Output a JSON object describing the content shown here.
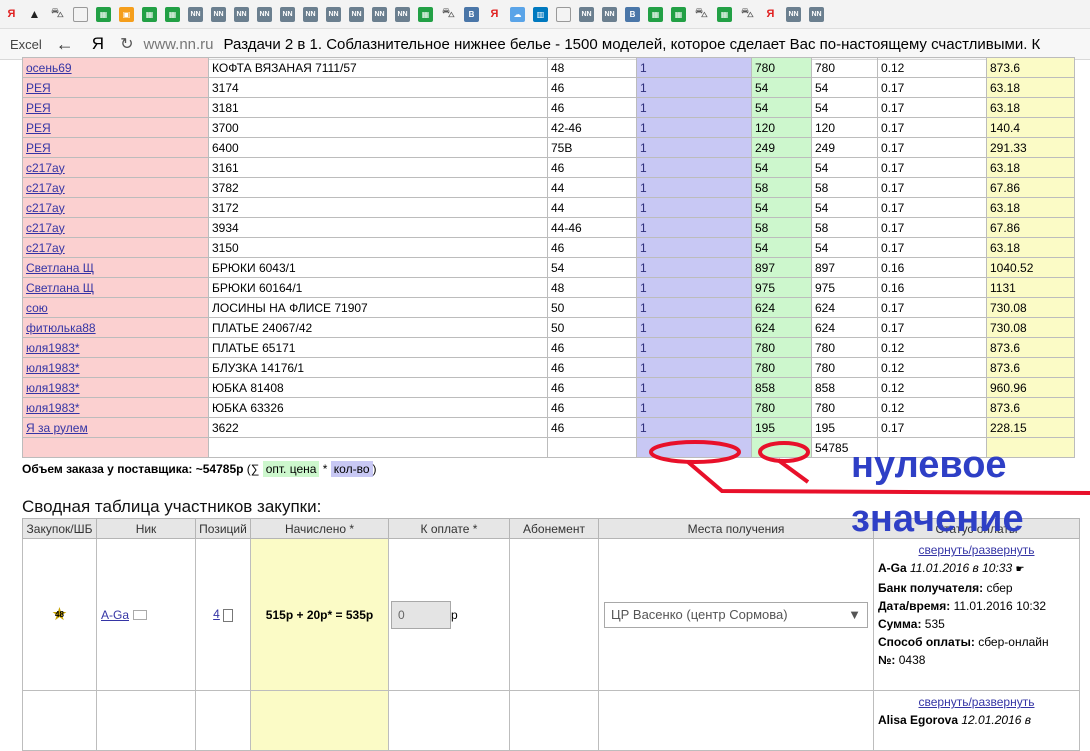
{
  "bookmarks": [
    "y-icon",
    "penguin-icon",
    "basket-icon",
    "doc-icon",
    "sheet-icon",
    "orange-icon",
    "sheet-icon",
    "sheet-icon",
    "nn-icon",
    "nn-icon",
    "nn-icon",
    "nn-icon",
    "nn-icon",
    "nn-icon",
    "nn-icon",
    "nn-icon",
    "nn-icon",
    "nn-icon",
    "sheet-icon",
    "basket-icon",
    "vk-icon",
    "y-icon",
    "cloud-icon",
    "trello-icon",
    "doc-icon",
    "nn-icon",
    "nn-icon",
    "vk-icon",
    "sheet-icon",
    "sheet-icon",
    "basket-icon",
    "sheet-icon",
    "basket-icon",
    "y-icon",
    "nn-icon",
    "nn-icon"
  ],
  "nn_label": "NN",
  "vk_label": "B",
  "y_label": "Я",
  "browser": {
    "app_label": "Excel",
    "back_glyph": "←",
    "logo": "Я",
    "reload_glyph": "↻",
    "url": "www.nn.ru",
    "page_title": "Раздачи 2 в 1. Соблазнительное нижнее белье - 1500 моделей, которое сделает Вас по-настоящему счастливыми. К"
  },
  "orders": [
    {
      "nick": "осень69",
      "item": "КОФТА ВЯЗАНАЯ 7111/57",
      "size": "48",
      "qty": "1",
      "price": "780",
      "price2": "780",
      "fee": "0.12",
      "total": "873.6"
    },
    {
      "nick": "РЕЯ",
      "item": "3174",
      "size": "46",
      "qty": "1",
      "price": "54",
      "price2": "54",
      "fee": "0.17",
      "total": "63.18"
    },
    {
      "nick": "РЕЯ",
      "item": "3181",
      "size": "46",
      "qty": "1",
      "price": "54",
      "price2": "54",
      "fee": "0.17",
      "total": "63.18"
    },
    {
      "nick": "РЕЯ",
      "item": "3700",
      "size": "42-46",
      "qty": "1",
      "price": "120",
      "price2": "120",
      "fee": "0.17",
      "total": "140.4"
    },
    {
      "nick": "РЕЯ",
      "item": "6400",
      "size": "75B",
      "qty": "1",
      "price": "249",
      "price2": "249",
      "fee": "0.17",
      "total": "291.33"
    },
    {
      "nick": "c217ay",
      "item": "3161",
      "size": "46",
      "qty": "1",
      "price": "54",
      "price2": "54",
      "fee": "0.17",
      "total": "63.18"
    },
    {
      "nick": "c217ay",
      "item": "3782",
      "size": "44",
      "qty": "1",
      "price": "58",
      "price2": "58",
      "fee": "0.17",
      "total": "67.86"
    },
    {
      "nick": "c217ay",
      "item": "3172",
      "size": "44",
      "qty": "1",
      "price": "54",
      "price2": "54",
      "fee": "0.17",
      "total": "63.18"
    },
    {
      "nick": "c217ay",
      "item": "3934",
      "size": "44-46",
      "qty": "1",
      "price": "58",
      "price2": "58",
      "fee": "0.17",
      "total": "67.86"
    },
    {
      "nick": "c217ay",
      "item": "3150",
      "size": "46",
      "qty": "1",
      "price": "54",
      "price2": "54",
      "fee": "0.17",
      "total": "63.18"
    },
    {
      "nick": "Светлана Щ",
      "item": "БРЮКИ 6043/1",
      "size": "54",
      "qty": "1",
      "price": "897",
      "price2": "897",
      "fee": "0.16",
      "total": "1040.52"
    },
    {
      "nick": "Светлана Щ",
      "item": "БРЮКИ 60164/1",
      "size": "48",
      "qty": "1",
      "price": "975",
      "price2": "975",
      "fee": "0.16",
      "total": "1131"
    },
    {
      "nick": "сою",
      "item": "ЛОСИНЫ НА ФЛИСЕ 71907",
      "size": "50",
      "qty": "1",
      "price": "624",
      "price2": "624",
      "fee": "0.17",
      "total": "730.08"
    },
    {
      "nick": "фитюлька88",
      "item": "ПЛАТЬЕ 24067/42",
      "size": "50",
      "qty": "1",
      "price": "624",
      "price2": "624",
      "fee": "0.17",
      "total": "730.08"
    },
    {
      "nick": "юля1983*",
      "item": "ПЛАТЬЕ 65171",
      "size": "46",
      "qty": "1",
      "price": "780",
      "price2": "780",
      "fee": "0.12",
      "total": "873.6"
    },
    {
      "nick": "юля1983*",
      "item": "БЛУЗКА 14176/1",
      "size": "46",
      "qty": "1",
      "price": "780",
      "price2": "780",
      "fee": "0.12",
      "total": "873.6"
    },
    {
      "nick": "юля1983*",
      "item": "ЮБКА 81408",
      "size": "46",
      "qty": "1",
      "price": "858",
      "price2": "858",
      "fee": "0.12",
      "total": "960.96"
    },
    {
      "nick": "юля1983*",
      "item": "ЮБКА 63326",
      "size": "46",
      "qty": "1",
      "price": "780",
      "price2": "780",
      "fee": "0.12",
      "total": "873.6"
    },
    {
      "nick": "Я за рулем",
      "item": "3622",
      "size": "46",
      "qty": "1",
      "price": "195",
      "price2": "195",
      "fee": "0.17",
      "total": "228.15"
    }
  ],
  "totals_row": {
    "sum": "54785"
  },
  "volume": {
    "label": "Объем заказа у поставщика:",
    "value": "~54785р",
    "open": "(∑",
    "chip_price": "опт. цена",
    "times": "*",
    "chip_qty": "кол-во",
    "close": ")"
  },
  "summary": {
    "title": "Сводная таблица участников закупки:",
    "headers": [
      "Закупок/ШБ",
      "Ник",
      "Позиций",
      "Начислено *",
      "К оплате *",
      "Абонемент",
      "Места получения",
      "Статус оплаты"
    ],
    "rows": [
      {
        "badge": "48",
        "nick": "A-Ga",
        "positions": "4",
        "formula": "515р + 20р* = 535р",
        "pay_value": "0",
        "pay_suffix": "р",
        "place": "ЦР Васенко (центр Сормова)",
        "toggle": "свернуть/развернуть",
        "pay_user": "A-Ga",
        "pay_time": "11.01.2016 в 10:33",
        "bank_label": "Банк получателя:",
        "bank_value": "сбер",
        "dt_label": "Дата/время:",
        "dt_value": "11.01.2016 10:32",
        "sum_label": "Сумма:",
        "sum_value": "535",
        "method_label": "Способ оплаты:",
        "method_value": "сбер-онлайн",
        "num_label": "№:",
        "num_value": "0438"
      },
      {
        "toggle": "свернуть/развернуть",
        "pay_user": "Alisa Egorova",
        "pay_time": "12.01.2016 в"
      }
    ]
  },
  "annotation": {
    "text_line1": "нулевое",
    "text_line2": "значение",
    "color": "#e8102a",
    "text_color": "#2e3fc6"
  }
}
